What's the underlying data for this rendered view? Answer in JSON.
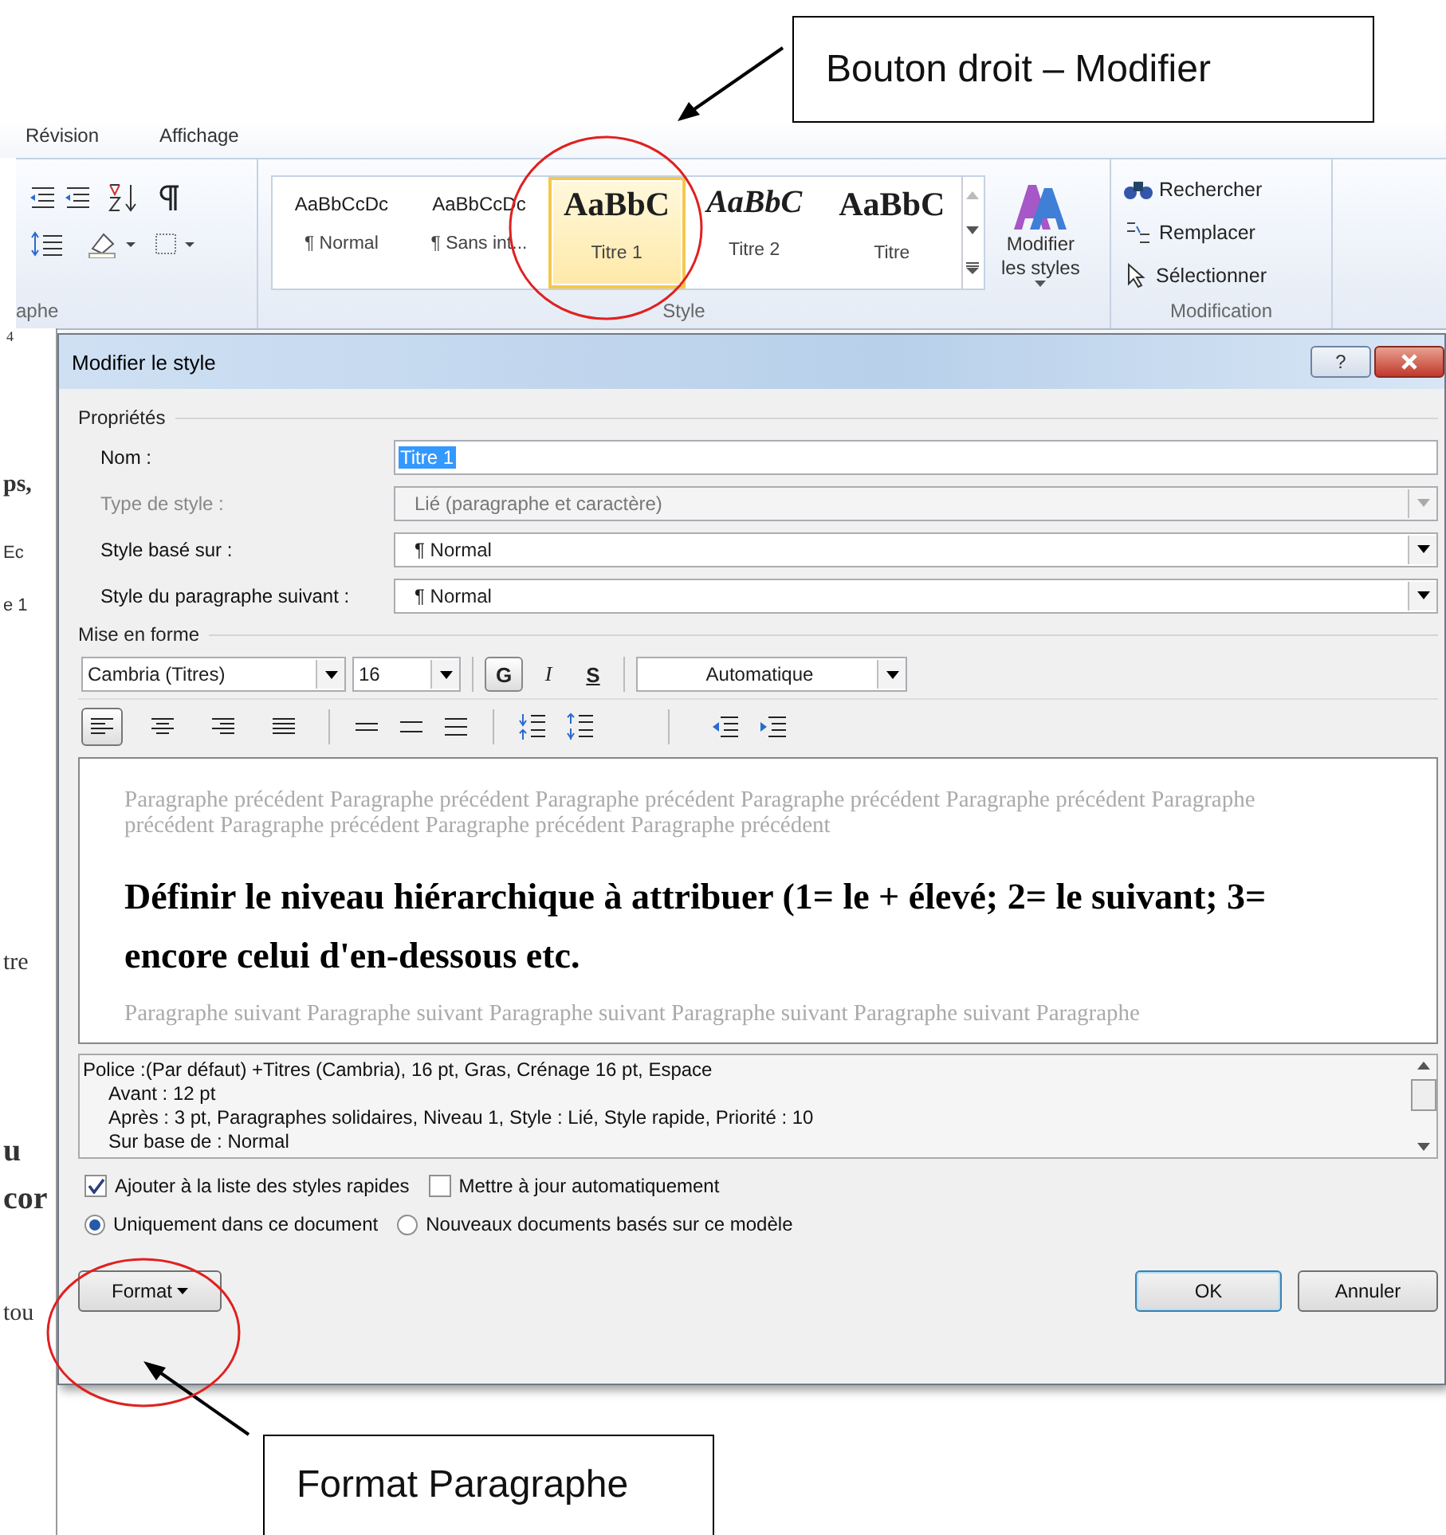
{
  "top_callout": {
    "text": "Bouton droit – Modifier"
  },
  "bottom_callout": {
    "text": "Format Paragraphe"
  },
  "ribbon": {
    "tabs": [
      {
        "label": "Révision"
      },
      {
        "label": "Affichage"
      }
    ],
    "paragraph_group": {
      "label": "aphe"
    },
    "style_group": {
      "label": "Style",
      "change_styles": [
        "Modifier",
        "les styles"
      ],
      "styles": [
        {
          "sample": "AaBbCcDc",
          "name": "¶ Normal",
          "kind": "plain",
          "selected": false
        },
        {
          "sample": "AaBbCcDc",
          "name": "¶ Sans int...",
          "kind": "plain",
          "selected": false
        },
        {
          "sample": "AaBbC",
          "name": "Titre 1",
          "kind": "heading",
          "selected": true
        },
        {
          "sample": "AaBbC",
          "name": "Titre 2",
          "kind": "italic",
          "selected": false
        },
        {
          "sample": "AaBbC",
          "name": "Titre",
          "kind": "heading",
          "selected": false
        }
      ]
    },
    "modification_group": {
      "label": "Modification",
      "items": [
        {
          "label": "Rechercher",
          "kind": "find"
        },
        {
          "label": "Remplacer",
          "kind": "replace"
        },
        {
          "label": "Sélectionner",
          "kind": "select"
        }
      ]
    }
  },
  "document_fragments": [
    "4",
    "ps,",
    "Ec",
    "e 1",
    "tre",
    "u",
    "cor",
    "tou"
  ],
  "dialog": {
    "title": "Modifier le style",
    "help": "?",
    "properties_label": "Propriétés",
    "fields": [
      {
        "label": "Nom :",
        "value": "Titre 1",
        "kind": "text"
      },
      {
        "label": "Type de style :",
        "value": "Lié (paragraphe et caractère)",
        "kind": "combo",
        "disabled": true
      },
      {
        "label": "Style basé sur :",
        "value": "¶ Normal",
        "kind": "combo",
        "disabled": false
      },
      {
        "label": "Style du paragraphe suivant :",
        "value": "¶ Normal",
        "kind": "combo",
        "disabled": false
      }
    ],
    "format_label": "Mise en forme",
    "font": "Cambria (Titres)",
    "size": "16",
    "styles_buttons": [
      {
        "label": "G",
        "kind": "bold",
        "selected": true
      },
      {
        "label": "I",
        "kind": "italic",
        "selected": false
      },
      {
        "label": "S",
        "kind": "underline",
        "selected": false
      }
    ],
    "color_choice": "Automatique",
    "align_buttons": [
      {
        "kind": "left",
        "selected": true
      },
      {
        "kind": "center",
        "selected": false
      },
      {
        "kind": "right",
        "selected": false
      },
      {
        "kind": "justify",
        "selected": false
      }
    ],
    "preview": {
      "previous": "Paragraphe précédent Paragraphe précédent Paragraphe précédent Paragraphe précédent Paragraphe précédent Paragraphe précédent Paragraphe précédent Paragraphe précédent Paragraphe précédent",
      "sample": "Définir le niveau hiérarchique à attribuer (1= le + élevé; 2= le suivant; 3= encore celui d'en-dessous etc.",
      "next": "Paragraphe suivant Paragraphe suivant Paragraphe suivant Paragraphe suivant Paragraphe suivant Paragraphe"
    },
    "description": [
      "Police :(Par défaut) +Titres (Cambria), 16 pt, Gras, Crénage 16 pt, Espace",
      "Avant : 12 pt",
      "Après : 3 pt, Paragraphes solidaires, Niveau 1, Style : Lié, Style rapide, Priorité : 10",
      "Sur base de : Normal"
    ],
    "checkboxes": [
      {
        "label": "Ajouter à la liste des styles rapides",
        "checked": true
      },
      {
        "label": "Mettre à jour automatiquement",
        "checked": false
      }
    ],
    "radios": [
      {
        "label": "Uniquement dans ce document",
        "selected": true
      },
      {
        "label": "Nouveaux documents basés sur ce modèle",
        "selected": false
      }
    ],
    "format_button": "Format",
    "ok": "OK",
    "cancel": "Annuler"
  }
}
